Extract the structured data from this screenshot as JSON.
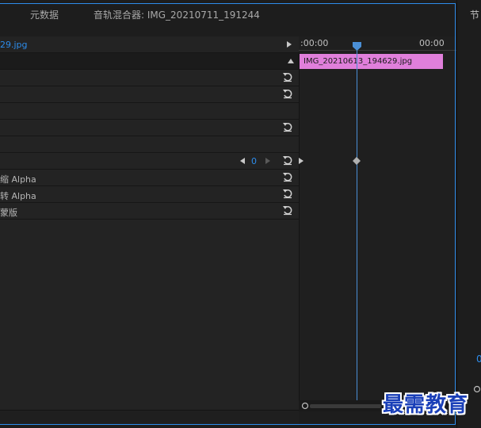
{
  "tabs": {
    "metadata": "元数据",
    "audio_mixer": "音轨混合器: IMG_20210711_191244"
  },
  "effect_controls": {
    "clip_name": "29.jpg",
    "keyframe_value": "0",
    "rows": [
      {
        "label": ""
      },
      {
        "label": ""
      },
      {
        "label": ""
      },
      {
        "label": ""
      },
      {
        "label": ""
      },
      {
        "label": ""
      },
      {
        "label": "缩 Alpha"
      },
      {
        "label": "转 Alpha"
      },
      {
        "label": "蒙版"
      }
    ]
  },
  "timeline": {
    "time_start": ":00:00",
    "time_end": "00:00",
    "clip_label": "IMG_20210613_194629.jpg"
  },
  "right_panel": {
    "title": "节",
    "value": "0"
  },
  "watermark": "最需教育",
  "colors": {
    "accent_blue": "#2d8ceb",
    "clip_pink": "#e07fdb",
    "panel_bg": "#232323"
  },
  "icons": [
    "play-right-icon",
    "collapse-up-icon",
    "reset-icon",
    "keyframe-prev-icon",
    "keyframe-next-icon",
    "keyframe-diamond-icon",
    "playhead-icon"
  ]
}
